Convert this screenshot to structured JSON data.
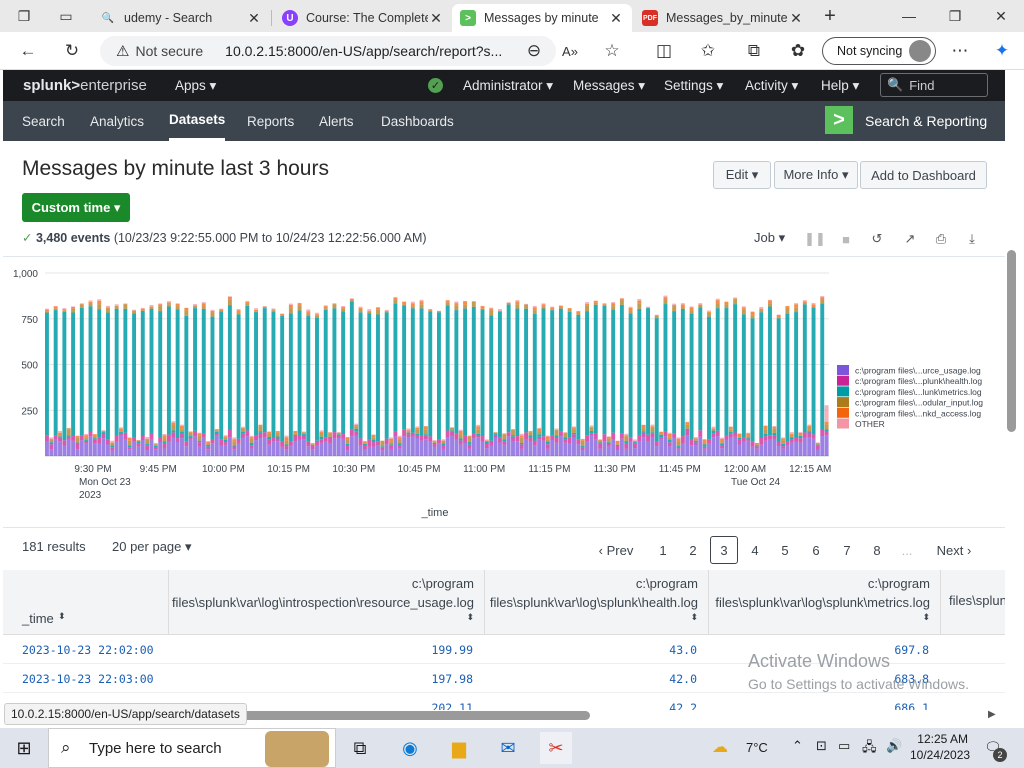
{
  "browser": {
    "tabs": [
      {
        "title": "udemy - Search",
        "favicon": "search-icon",
        "favicon_color": "#5f6368"
      },
      {
        "title": "Course: The Complete",
        "favicon": "udemy-icon",
        "favicon_color": "#8a3ffc"
      },
      {
        "title": "Messages by minute",
        "favicon": "splunk-icon",
        "favicon_color": "#5cc05c"
      },
      {
        "title": "Messages_by_minute",
        "favicon": "pdf-icon",
        "favicon_color": "#d93025"
      }
    ],
    "security": "Not secure",
    "url": "10.0.2.15:8000/en-US/app/search/report?s...",
    "sync": "Not syncing"
  },
  "splunk": {
    "logo_a": "splunk>",
    "logo_b": "enterprise",
    "top_menus": [
      "Apps ▾",
      "Administrator ▾",
      "Messages ▾",
      "Settings ▾",
      "Activity ▾",
      "Help ▾"
    ],
    "find_placeholder": "Find",
    "app_nav": [
      "Search",
      "Analytics",
      "Datasets",
      "Reports",
      "Alerts",
      "Dashboards"
    ],
    "app_name": "Search & Reporting"
  },
  "report": {
    "title": "Messages by minute last 3 hours",
    "edit": "Edit ▾",
    "more_info": "More Info ▾",
    "add_dash": "Add to Dashboard",
    "time_button": "Custom time ▾",
    "events_check": "✓",
    "events_count": "3,480 events",
    "events_range": "(10/23/23 9:22:55.000 PM to 10/24/23 12:22:56.000 AM)",
    "job": "Job ▾"
  },
  "chart_data": {
    "type": "area",
    "xlabel": "_time",
    "ylabel": "",
    "ylim": [
      0,
      1000
    ],
    "y_ticks": [
      "250",
      "500",
      "750",
      "1,000"
    ],
    "x_ticks": [
      {
        "label": "9:30 PM",
        "sub1": "Mon Oct 23",
        "sub2": "2023"
      },
      {
        "label": "9:45 PM"
      },
      {
        "label": "10:00 PM"
      },
      {
        "label": "10:15 PM"
      },
      {
        "label": "10:30 PM"
      },
      {
        "label": "10:45 PM"
      },
      {
        "label": "11:00 PM"
      },
      {
        "label": "11:15 PM"
      },
      {
        "label": "11:30 PM"
      },
      {
        "label": "11:45 PM"
      },
      {
        "label": "12:00 AM",
        "sub1": "Tue Oct 24"
      },
      {
        "label": "12:15 AM"
      }
    ],
    "stacked": true,
    "legend_position": "right",
    "series": [
      {
        "name": "c:\\program files\\...urce_usage.log",
        "color": "#7b56db",
        "typical": 200
      },
      {
        "name": "c:\\program files\\...plunk\\health.log",
        "color": "#cb2196",
        "typical": 42
      },
      {
        "name": "c:\\program files\\...lunk\\metrics.log",
        "color": "#009ca6",
        "typical": 690
      },
      {
        "name": "c:\\program files\\...odular_input.log",
        "color": "#ac7b1b",
        "typical": 30
      },
      {
        "name": "c:\\program files\\...nkd_access.log",
        "color": "#f3650c",
        "typical": 20
      },
      {
        "name": "OTHER",
        "color": "#f495a6",
        "typical": 10
      }
    ]
  },
  "pager": {
    "results": "181 results",
    "per_page": "20 per page ▾",
    "prev": "‹ Prev",
    "pages": [
      "1",
      "2",
      "3",
      "4",
      "5",
      "6",
      "7",
      "8",
      "..."
    ],
    "next": "Next ›"
  },
  "table": {
    "time_header": "_time",
    "col_headers": [
      {
        "l1": "c:\\program",
        "l2": "files\\splunk\\var\\log\\introspection\\resource_usage.log"
      },
      {
        "l1": "c:\\program",
        "l2": "files\\splunk\\var\\log\\splunk\\health.log"
      },
      {
        "l1": "c:\\program",
        "l2": "files\\splunk\\var\\log\\splunk\\metrics.log"
      },
      {
        "l1": "",
        "l2": "files\\splun"
      }
    ],
    "rows": [
      {
        "time": "2023-10-23 22:02:00",
        "v1": "199.99",
        "v2": "43.0",
        "v3": "697.8"
      },
      {
        "time": "2023-10-23 22:03:00",
        "v1": "197.98",
        "v2": "42.0",
        "v3": "683.8"
      },
      {
        "time": "",
        "v1": "202.11",
        "v2": "42.2",
        "v3": "686.1"
      }
    ]
  },
  "windows": {
    "watermark1": "Activate Windows",
    "watermark2": "Go to Settings to activate Windows.",
    "search": "Type here to search",
    "temp": "7°C",
    "time": "12:25 AM",
    "date": "10/24/2023",
    "notif": "2"
  },
  "status_url": "10.0.2.15:8000/en-US/app/search/datasets"
}
